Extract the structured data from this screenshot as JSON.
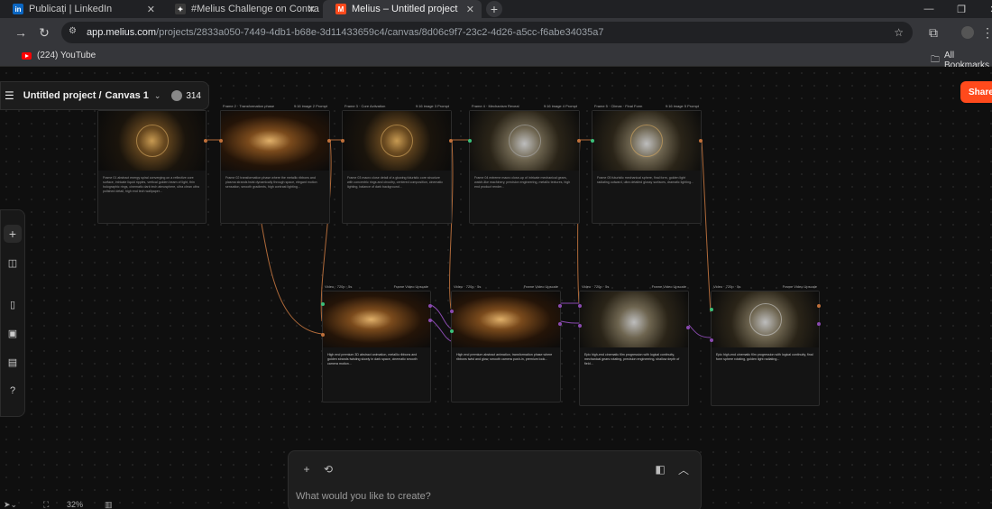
{
  "browser": {
    "tabs": [
      {
        "label": "Publicați | LinkedIn",
        "favicon": "in",
        "favicon_color": "#0a66c2"
      },
      {
        "label": "#Melius Challenge on Contra",
        "favicon": "✦",
        "favicon_color": "#3a3a3a"
      },
      {
        "label": "Melius – Untitled project",
        "favicon": "M",
        "favicon_color": "#ff4a1c"
      }
    ],
    "url_host": "app.melius.com",
    "url_path": "/projects/2833a050-7449-4db1-b68e-3d11433659c4/canvas/8d06c9f7-23c2-4d26-a5cc-f6abe34035a7",
    "bookmark": "(224) YouTube",
    "all_bookmarks": "All Bookmarks"
  },
  "app": {
    "project_title": "Untitled project /",
    "canvas_name": "Canvas 1",
    "credits": "314",
    "share_label": "Share",
    "accent": "#ff4a1c"
  },
  "prompt": {
    "placeholder": "What would you like to create?"
  },
  "bottom": {
    "zoom": "32%"
  },
  "image_cards": [
    {
      "header_left": "",
      "header_right": "",
      "text": "Frame 01 abstract energy spiral converging on a reflective core surface, intricate liquid ripples, vertical golden beam of light, thin holographic rings, cinematic dark tech atmosphere, ultra clean ultra polished detail, high end tech wallpaper..."
    },
    {
      "header_left": "Frame 2 · Transformation phase",
      "header_right": "9:16 image 2 Prompt",
      "text": "Frame 02 transformation phase where the metallic ribbons and plasma strands twist dynamically through space, elegant motion sensation, smooth gradients, high contrast lighting..."
    },
    {
      "header_left": "Frame 3 · Core Activation",
      "header_right": "9:16 image 3 Prompt",
      "text": "Frame 03 macro close detail of a glowing futuristic core structure with concentric rings and circuitry, centered composition, cinematic lighting, balance of dark background..."
    },
    {
      "header_left": "Frame 4 · Mechanism Reveal",
      "header_right": "9:16 image 4 Prompt",
      "text": "Frame 04 extreme macro close-up of intricate mechanical gears, watch-like machinery, precision engineering, metallic textures, high end product render..."
    },
    {
      "header_left": "Frame 5 · Climax · Final Form",
      "header_right": "9:16 image 5 Prompt",
      "text": "Frame 05 futuristic mechanical sphere, final form, golden light radiating outward, ultra detailed glossy surfaces, dramatic lighting..."
    }
  ],
  "video_cards": [
    {
      "header_left": "Video · 720p · 5s",
      "header_right": "Frame Video Upscale",
      "text": "High end premium 3D abstract animation, metallic ribbons and golden strands twisting slowly in dark space, cinematic smooth camera motion..."
    },
    {
      "header_left": "Video · 720p · 5s",
      "header_right": "Frame Video Upscale",
      "text": "High end premium abstract animation, transformation phase where ribbons twist and glow, smooth camera push-in, premium look..."
    },
    {
      "header_left": "Video · 720p · 5s",
      "header_right": "Frame Video Upscale",
      "text": "Epic high-end cinematic film progression with logical continuity, mechanical gears rotating, precision engineering, shallow depth of field..."
    },
    {
      "header_left": "Video · 720p · 5s",
      "header_right": "Frame Video Upscale",
      "text": "Epic high-end cinematic film progression with logical continuity, final form sphere rotating, golden light radiating..."
    }
  ]
}
